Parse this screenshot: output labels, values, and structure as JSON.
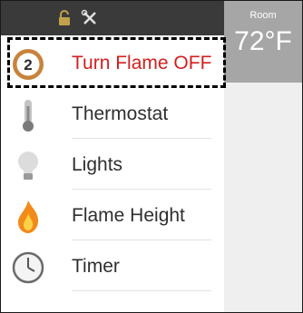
{
  "header": {
    "lock_icon": "lock-icon",
    "tools_icon": "tools-icon"
  },
  "room": {
    "label": "Room",
    "temperature": "72°F"
  },
  "menu": {
    "items": [
      {
        "id": "turn-flame-off",
        "label": "Turn Flame OFF",
        "icon": "flame-power-icon",
        "badge": "2",
        "active": true,
        "color": "#d21f1f"
      },
      {
        "id": "thermostat",
        "label": "Thermostat",
        "icon": "thermometer-icon"
      },
      {
        "id": "lights",
        "label": "Lights",
        "icon": "light-bulb-icon"
      },
      {
        "id": "flame-height",
        "label": "Flame Height",
        "icon": "flame-icon"
      },
      {
        "id": "timer",
        "label": "Timer",
        "icon": "clock-icon"
      }
    ]
  }
}
